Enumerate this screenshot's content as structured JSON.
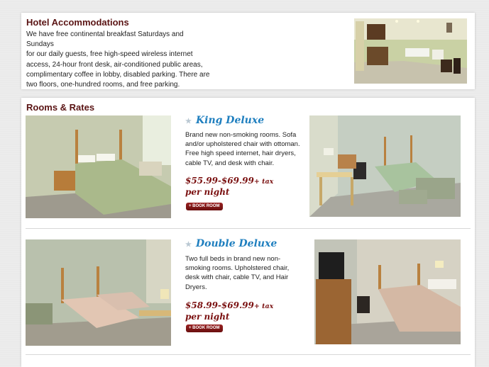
{
  "hotel": {
    "title": "Hotel Accommodations",
    "lines": [
      "We have free continental breakfast Saturdays and Sundays",
      "for our daily guests, free high-speed wireless internet",
      "access, 24-hour front desk, air-conditioned public areas,",
      "complimentary coffee in lobby, disabled parking. There are",
      "two floors, one-hundred rooms, and free parking."
    ]
  },
  "rooms": {
    "title": "Rooms & Rates",
    "items": [
      {
        "name": "King Deluxe",
        "lines": [
          "Brand new non-smoking rooms. Sofa",
          "and/or upholstered chair with ottoman.",
          "Free high speed internet, hair dryers,",
          "cable TV, and desk with chair."
        ],
        "price": "$55.99-$69.99",
        "tax": "+ tax",
        "price_suffix": "per night",
        "book_label": "+ BOOK ROOM"
      },
      {
        "name": "Double Deluxe",
        "lines": [
          "Two full beds in brand new non-",
          "smoking rooms. Upholstered chair,",
          "desk with chair, cable TV, and Hair",
          "Dryers."
        ],
        "price": "$58.99-$69.99",
        "tax": "+ tax",
        "price_suffix": "per night",
        "book_label": "+ BOOK ROOM"
      }
    ]
  },
  "colors": {
    "heading": "#5a1414",
    "room_title": "#1f7fbf",
    "price": "#7a1010",
    "button": "#7d1515"
  },
  "icons": {
    "room_bullet": "star-icon"
  }
}
